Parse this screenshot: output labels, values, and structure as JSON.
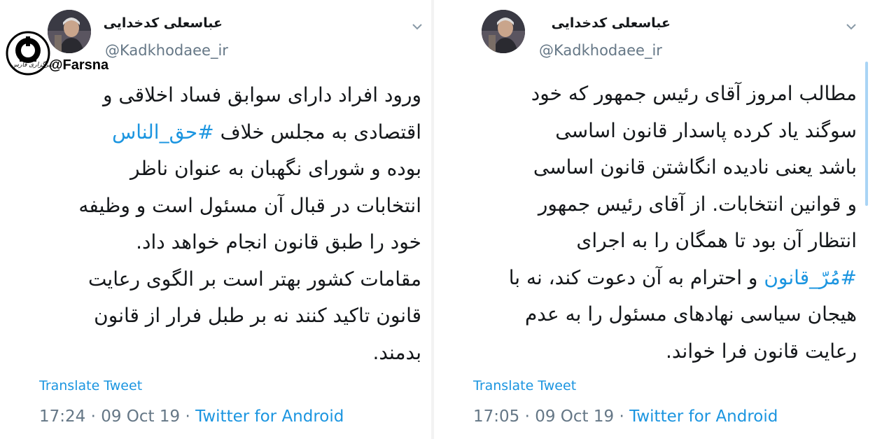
{
  "watermark": {
    "text": "@Farsna",
    "script_text": "خبرگزاری فارس"
  },
  "tweets": [
    {
      "author_name": "عباسعلی کدخدایی",
      "handle": "@Kadkhodaee_ir",
      "lines": [
        "ورود افراد دارای سوابق فساد اخلاقی و",
        "#حق_الناس",
        "بوده و شورای نگهبان به عنوان ناظر",
        "انتخابات در قبال آن مسئول است و وظیفه",
        "خود را طبق قانون انجام خواهد داد.",
        "مقامات کشور بهتر است بر الگوی رعایت",
        "قانون تاکید کنند نه بر طبل فرار از قانون",
        "بدمند."
      ],
      "line2_prefix": "اقتصادی به مجلس خلاف",
      "translate_label": "Translate Tweet",
      "time": "17:24",
      "date": "09 Oct 19",
      "source": "Twitter for Android",
      "separator": "·"
    },
    {
      "author_name": "عباسعلی کدخدایی",
      "handle": "@Kadkhodaee_ir",
      "lines": [
        "مطالب امروز آقای رئیس جمهور که خود",
        "سوگند یاد کرده پاسدار قانون اساسی",
        "باشد یعنی نادیده انگاشتن قانون اساسی",
        "و قوانین انتخابات. از آقای رئیس جمهور",
        "انتظار آن بود تا همگان را به اجرای",
        "#مُرّ_قانون",
        "هیجان سیاسی نهادهای مسئول را به عدم",
        "رعایت قانون فرا خواند."
      ],
      "line6_suffix": "و احترام به آن دعوت کند، نه با",
      "translate_label": "Translate Tweet",
      "time": "17:05",
      "date": "09 Oct 19",
      "source": "Twitter for Android",
      "separator": "·"
    }
  ],
  "colors": {
    "link": "#1b95e0",
    "muted": "#657786",
    "text": "#14171a"
  },
  "icons": {
    "chevron": "chevron-down-icon",
    "avatar": "avatar"
  }
}
